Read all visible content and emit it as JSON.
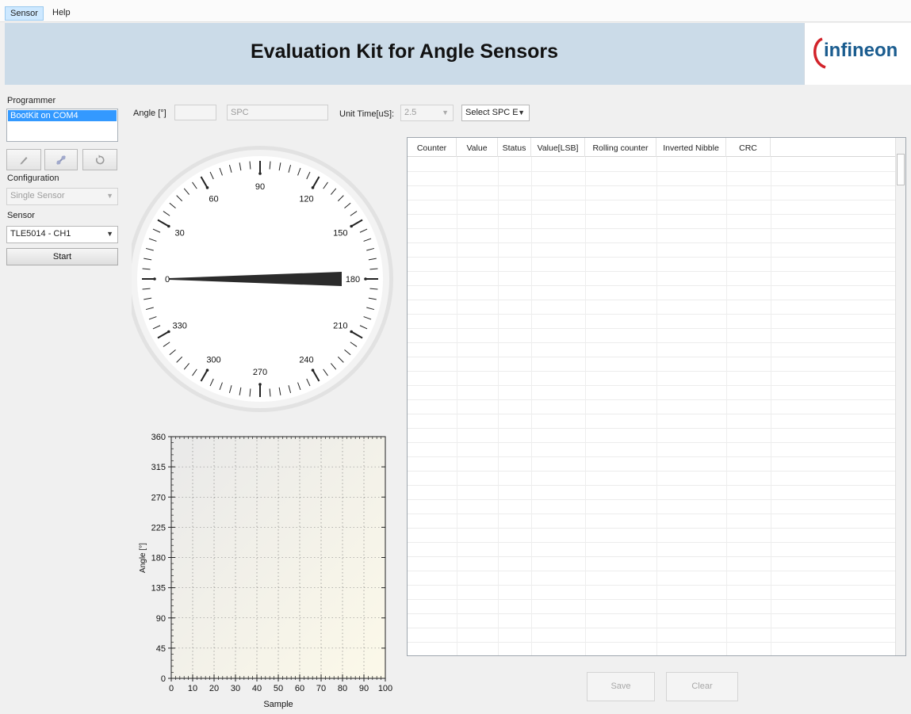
{
  "menu": {
    "items": [
      "Sensor",
      "Help"
    ]
  },
  "header": {
    "title": "Evaluation Kit for Angle Sensors",
    "logo_text": "infineon"
  },
  "sidebar": {
    "programmer_label": "Programmer",
    "programmer_items": [
      "BootKit on COM4"
    ],
    "tool_buttons": [
      "pencil-icon",
      "connect-icon",
      "refresh-icon"
    ],
    "configuration_label": "Configuration",
    "configuration_value": "Single Sensor",
    "sensor_label": "Sensor",
    "sensor_value": "TLE5014 - CH1",
    "start_label": "Start"
  },
  "toolbar": {
    "angle_label": "Angle  [°]",
    "angle_value": "",
    "protocol_value": "SPC",
    "unit_time_label": "Unit Time[uS]:",
    "unit_time_value": "2.5",
    "select_spc_label": "Select SPC E"
  },
  "gauge": {
    "labels": [
      "0",
      "30",
      "60",
      "90",
      "120",
      "150",
      "180",
      "210",
      "240",
      "270",
      "300",
      "330"
    ],
    "needle_angle_deg": 180
  },
  "table": {
    "columns": [
      "Counter",
      "Value",
      "Status",
      "Value[LSB]",
      "Rolling counter",
      "Inverted Nibble",
      "CRC"
    ],
    "rows": []
  },
  "actions": {
    "save_label": "Save",
    "clear_label": "Clear"
  },
  "chart_data": {
    "type": "line",
    "title": "",
    "xlabel": "Sample",
    "ylabel": "Angle [°]",
    "xlim": [
      0,
      100
    ],
    "ylim": [
      0,
      360
    ],
    "xticks": [
      0,
      10,
      20,
      30,
      40,
      50,
      60,
      70,
      80,
      90,
      100
    ],
    "yticks": [
      0,
      45,
      90,
      135,
      180,
      225,
      270,
      315,
      360
    ],
    "grid": true,
    "series": []
  }
}
